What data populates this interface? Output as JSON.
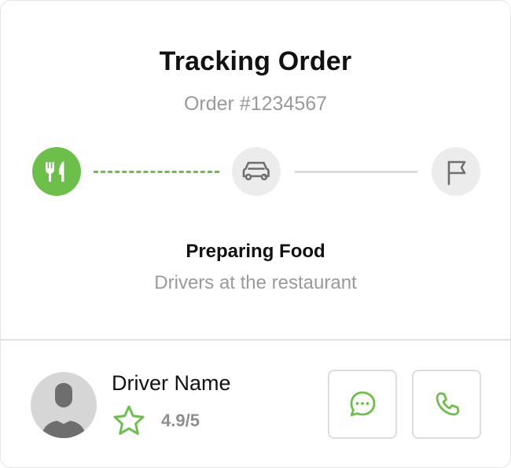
{
  "header": {
    "title": "Tracking Order",
    "order_number": "Order #1234567"
  },
  "progress": {
    "steps": [
      {
        "icon": "fork-knife-icon",
        "state": "active"
      },
      {
        "icon": "car-icon",
        "state": "pending"
      },
      {
        "icon": "flag-icon",
        "state": "pending"
      }
    ],
    "segments": [
      "in-progress",
      "pending"
    ]
  },
  "status": {
    "title": "Preparing Food",
    "subtitle": "Drivers at the restaurant"
  },
  "driver": {
    "name": "Driver Name",
    "rating": "4.9/5",
    "avatar_icon": "person-silhouette-icon",
    "rating_icon": "star-icon"
  },
  "actions": {
    "chat_icon": "chat-bubble-icon",
    "call_icon": "phone-icon"
  },
  "colors": {
    "accent": "#6cc04a",
    "inactive_circle": "#ececec",
    "inactive_icon": "#6f6f6f",
    "inactive_line": "#d9d9d9",
    "text_muted": "#9a9a9a"
  }
}
